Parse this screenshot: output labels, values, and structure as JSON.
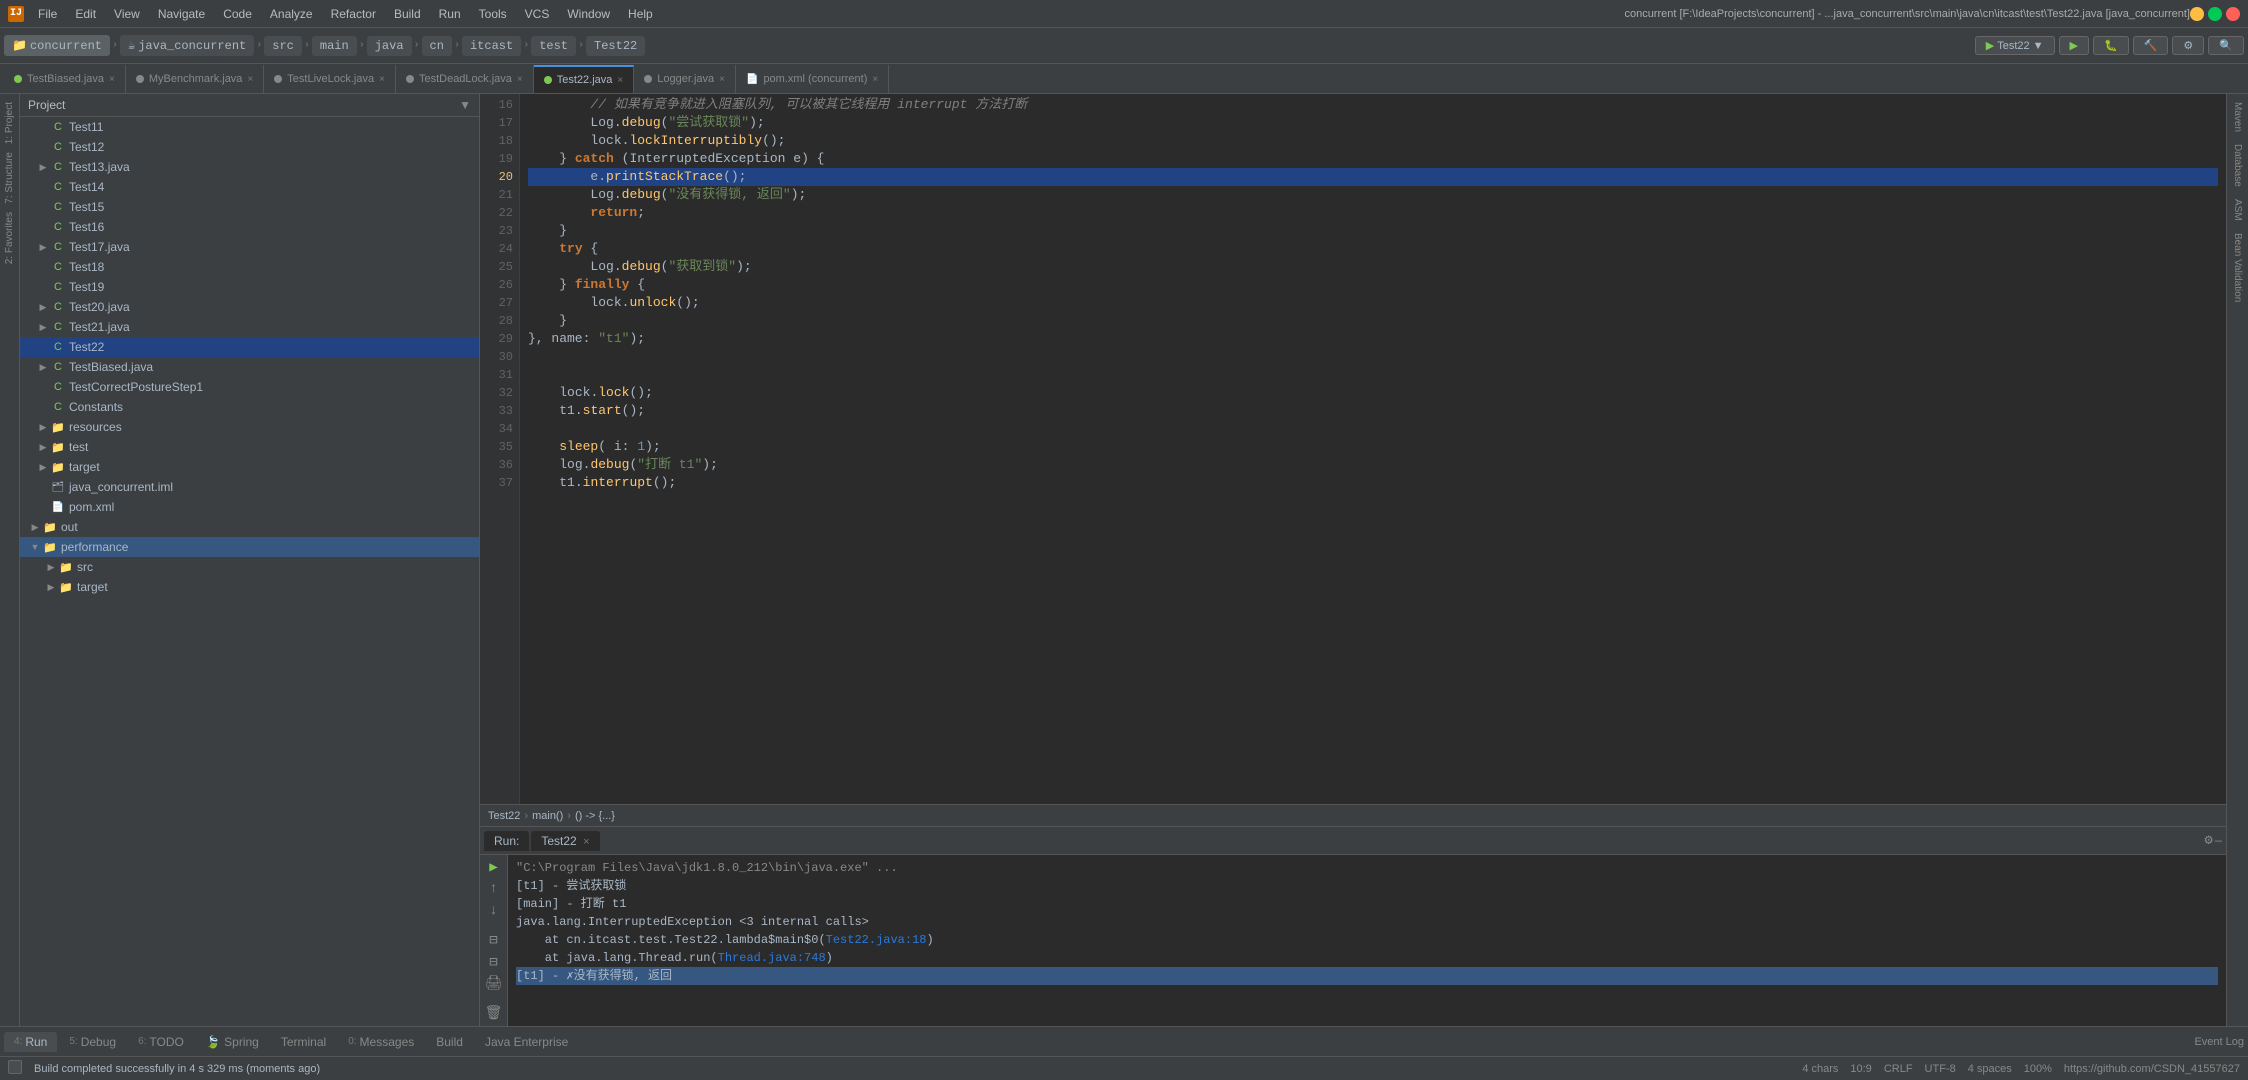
{
  "titlebar": {
    "title": "concurrent [F:\\IdeaProjects\\concurrent] - ...java_concurrent\\src\\main\\java\\cn\\itcast\\test\\Test22.java [java_concurrent]",
    "menus": [
      "File",
      "Edit",
      "View",
      "Navigate",
      "Code",
      "Analyze",
      "Refactor",
      "Build",
      "Run",
      "Tools",
      "VCS",
      "Window",
      "Help"
    ]
  },
  "breadcrumb": {
    "items": [
      "concurrent",
      "java_concurrent",
      "src",
      "main",
      "java",
      "cn",
      "itcast",
      "test",
      "Test22"
    ]
  },
  "run_toolbar": {
    "run_config": "Test22",
    "run_config_arrow": "▼"
  },
  "tabs": [
    {
      "label": "TestBiased.java",
      "closable": true
    },
    {
      "label": "MyBenchmark.java",
      "closable": true
    },
    {
      "label": "TestLiveLock.java",
      "closable": true
    },
    {
      "label": "TestDeadLock.java",
      "closable": true
    },
    {
      "label": "Test22.java",
      "active": true,
      "closable": true
    },
    {
      "label": "Logger.java",
      "closable": true
    },
    {
      "label": "pom.xml (concurrent)",
      "closable": true
    }
  ],
  "project_tree": {
    "header": "Project",
    "items": [
      {
        "level": 0,
        "label": "Test11",
        "type": "class",
        "hasArrow": false
      },
      {
        "level": 0,
        "label": "Test12",
        "type": "class",
        "hasArrow": false
      },
      {
        "level": 0,
        "label": "Test13.java",
        "type": "java",
        "hasArrow": true,
        "expanded": false
      },
      {
        "level": 0,
        "label": "Test14",
        "type": "class",
        "hasArrow": false
      },
      {
        "level": 0,
        "label": "Test15",
        "type": "class",
        "hasArrow": false
      },
      {
        "level": 0,
        "label": "Test16",
        "type": "class",
        "hasArrow": false
      },
      {
        "level": 0,
        "label": "Test17.java",
        "type": "java",
        "hasArrow": true,
        "expanded": false
      },
      {
        "level": 0,
        "label": "Test18",
        "type": "class",
        "hasArrow": false
      },
      {
        "level": 0,
        "label": "Test19",
        "type": "class",
        "hasArrow": false
      },
      {
        "level": 0,
        "label": "Test20.java",
        "type": "java",
        "hasArrow": true,
        "expanded": false
      },
      {
        "level": 0,
        "label": "Test21.java",
        "type": "java",
        "hasArrow": true,
        "expanded": false
      },
      {
        "level": 0,
        "label": "Test22",
        "type": "class",
        "hasArrow": false,
        "selected": true
      },
      {
        "level": 0,
        "label": "TestBiased.java",
        "type": "java",
        "hasArrow": true,
        "expanded": false
      },
      {
        "level": 0,
        "label": "TestCorrectPostureStep1",
        "type": "class",
        "hasArrow": false
      },
      {
        "level": 0,
        "label": "Constants",
        "type": "class",
        "hasArrow": false
      },
      {
        "level": 0,
        "label": "resources",
        "type": "folder",
        "hasArrow": true,
        "expanded": false
      },
      {
        "level": 0,
        "label": "test",
        "type": "folder",
        "hasArrow": true,
        "expanded": false
      },
      {
        "level": 0,
        "label": "target",
        "type": "folder",
        "hasArrow": true,
        "expanded": false
      },
      {
        "level": 0,
        "label": "java_concurrent.iml",
        "type": "xml",
        "hasArrow": false
      },
      {
        "level": 0,
        "label": "pom.xml",
        "type": "xml",
        "hasArrow": false
      },
      {
        "level": 0,
        "label": "out",
        "type": "folder",
        "hasArrow": true,
        "expanded": false
      },
      {
        "level": 0,
        "label": "performance",
        "type": "folder",
        "hasArrow": true,
        "expanded": true,
        "highlighted": true
      },
      {
        "level": 1,
        "label": "src",
        "type": "folder",
        "hasArrow": true,
        "expanded": false
      },
      {
        "level": 1,
        "label": "target",
        "type": "folder",
        "hasArrow": true,
        "expanded": false
      }
    ]
  },
  "code": {
    "lines": [
      {
        "num": 16,
        "content": "        // 如果有竞争就进入阻塞队列, 可以被其它线程用 interrupt 方法打断",
        "type": "comment"
      },
      {
        "num": 17,
        "content": "        Log.debug(\"尝试获取锁\");",
        "type": "code"
      },
      {
        "num": 18,
        "content": "        lock.lockInterruptibly();",
        "type": "code"
      },
      {
        "num": 19,
        "content": "    } catch (InterruptedException e) {",
        "type": "code"
      },
      {
        "num": 20,
        "content": "        e.printStackTrace();",
        "type": "code",
        "selected": true
      },
      {
        "num": 21,
        "content": "        Log.debug(\"没有获得锁, 返回\");",
        "type": "code"
      },
      {
        "num": 22,
        "content": "        return;",
        "type": "code"
      },
      {
        "num": 23,
        "content": "    }",
        "type": "code"
      },
      {
        "num": 24,
        "content": "    try {",
        "type": "code"
      },
      {
        "num": 25,
        "content": "        Log.debug(\"获取到锁\");",
        "type": "code"
      },
      {
        "num": 26,
        "content": "    } finally {",
        "type": "code"
      },
      {
        "num": 27,
        "content": "        lock.unlock();",
        "type": "code"
      },
      {
        "num": 28,
        "content": "    }",
        "type": "code"
      },
      {
        "num": 29,
        "content": "}, name: \"t1\");",
        "type": "code"
      },
      {
        "num": 30,
        "content": "",
        "type": "code"
      },
      {
        "num": 31,
        "content": "",
        "type": "code"
      },
      {
        "num": 32,
        "content": "    lock.lock();",
        "type": "code"
      },
      {
        "num": 33,
        "content": "    t1.start();",
        "type": "code"
      },
      {
        "num": 34,
        "content": "",
        "type": "code"
      },
      {
        "num": 35,
        "content": "    sleep( i: 1);",
        "type": "code"
      },
      {
        "num": 36,
        "content": "    log.debug(\"打断 t1\");",
        "type": "code"
      },
      {
        "num": 37,
        "content": "    t1.interrupt();",
        "type": "code"
      }
    ]
  },
  "editor_breadcrumb": {
    "items": [
      "Test22",
      "main()",
      "() -> {...}"
    ]
  },
  "run_panel": {
    "tab_label": "Run:",
    "run_config": "Test22",
    "settings_icon": "⚙",
    "minimize_icon": "—",
    "output_lines": [
      {
        "text": "\"C:\\Program Files\\Java\\jdk1.8.0_212\\bin\\java.exe\" ...",
        "type": "cmd"
      },
      {
        "text": "[t1] - 尝试获取锁",
        "type": "normal"
      },
      {
        "text": "[main] - 打断 t1",
        "type": "normal"
      },
      {
        "text": "java.lang.InterruptedException <3 internal calls>",
        "type": "normal"
      },
      {
        "text": "    at cn.itcast.test.Test22.lambda$main$0(Test22.java:18)",
        "type": "link"
      },
      {
        "text": "    at java.lang.Thread.run(Thread.java:748)",
        "type": "link"
      },
      {
        "text": "[t1] - ✗没有获得锁, 返回",
        "type": "highlight"
      }
    ]
  },
  "bottom_tabs": [
    {
      "num": "4",
      "label": "Run"
    },
    {
      "num": "5",
      "label": "Debug"
    },
    {
      "num": "6",
      "label": "TODO"
    },
    {
      "num": "",
      "label": "Spring"
    },
    {
      "num": "",
      "label": "Terminal"
    },
    {
      "num": "0",
      "label": "Messages"
    },
    {
      "num": "",
      "label": "Build"
    },
    {
      "num": "",
      "label": "Java Enterprise"
    }
  ],
  "status_bar": {
    "build_message": "Build completed successfully in 4 s 329 ms (moments ago)",
    "chars": "4 chars",
    "position": "10:9",
    "line_sep": "CRLF",
    "encoding": "UTF-8",
    "indent": "4 spaces",
    "zoom": "100%",
    "git_branch": "https://github.com/CSDN_41557627"
  },
  "right_labels": [
    "Maven",
    "Database",
    "ASM",
    "Bean Validation"
  ],
  "left_labels": [
    "1: Project",
    "7: Structure",
    "2: Favorites"
  ]
}
